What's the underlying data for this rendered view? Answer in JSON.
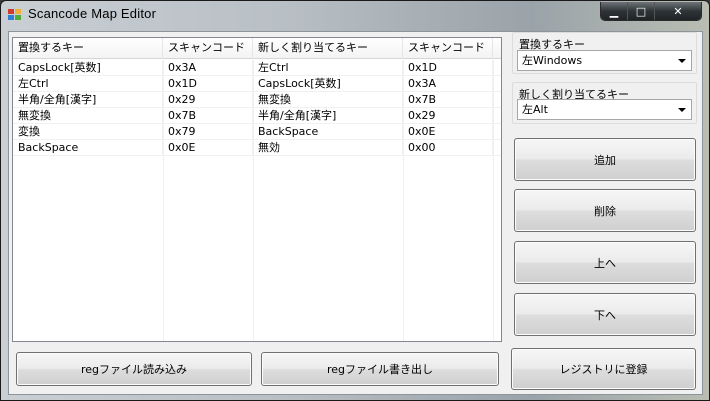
{
  "window": {
    "title": "Scancode Map Editor",
    "controls": {
      "minimize": "▁",
      "maximize": "□",
      "close": "✕"
    }
  },
  "list": {
    "headers": [
      "置換するキー",
      "スキャンコード",
      "新しく割り当てるキー",
      "スキャンコード"
    ],
    "rows": [
      [
        "CapsLock[英数]",
        "0x3A",
        "左Ctrl",
        "0x1D"
      ],
      [
        "左Ctrl",
        "0x1D",
        "CapsLock[英数]",
        "0x3A"
      ],
      [
        "半角/全角[漢字]",
        "0x29",
        "無変換",
        "0x7B"
      ],
      [
        "無変換",
        "0x7B",
        "半角/全角[漢字]",
        "0x29"
      ],
      [
        "変換",
        "0x79",
        "BackSpace",
        "0x0E"
      ],
      [
        "BackSpace",
        "0x0E",
        "無効",
        "0x00"
      ]
    ]
  },
  "replace_key": {
    "label": "置換するキー",
    "value": "左Windows"
  },
  "new_key": {
    "label": "新しく割り当てるキー",
    "value": "左Alt"
  },
  "buttons": {
    "add": "追加",
    "delete": "削除",
    "up": "上へ",
    "down": "下へ",
    "read_reg": "regファイル読み込み",
    "write_reg": "regファイル書き出し",
    "register": "レジストリに登録"
  }
}
